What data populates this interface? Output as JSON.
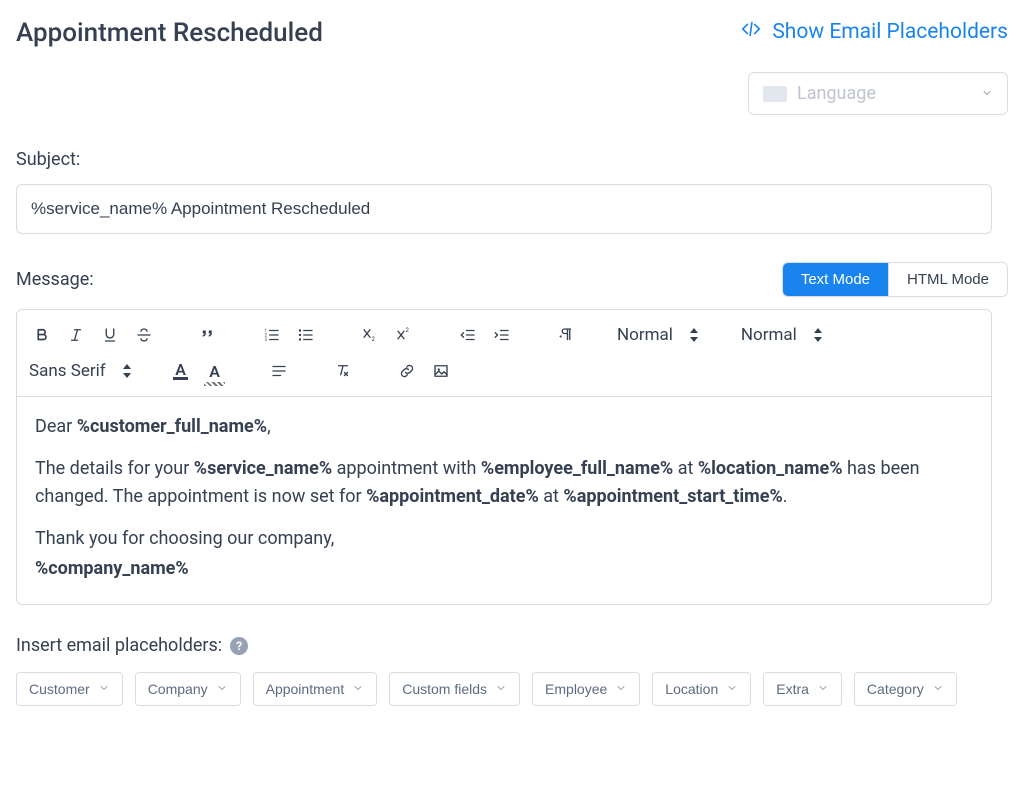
{
  "header": {
    "title": "Appointment Rescheduled",
    "show_placeholders": "Show Email Placeholders",
    "language_placeholder": "Language"
  },
  "subject": {
    "label": "Subject:",
    "value": "%service_name% Appointment Rescheduled"
  },
  "message": {
    "label": "Message:",
    "modes": {
      "text": "Text Mode",
      "html": "HTML Mode",
      "active": "text"
    }
  },
  "toolbar": {
    "select_size": "Normal",
    "select_heading": "Normal",
    "select_font": "Sans Serif"
  },
  "body": {
    "p1": {
      "t1": "Dear ",
      "v1": "%customer_full_name%",
      "t2": ","
    },
    "p2": {
      "t1": "The details for your ",
      "v1": "%service_name%",
      "t2": " appointment with ",
      "v2": "%employee_full_name%",
      "t3": " at ",
      "v3": "%location_name%",
      "t4": " has been changed. The appointment is now set for ",
      "v4": "%appointment_date%",
      "t5": " at ",
      "v5": "%appointment_start_time%",
      "t6": "."
    },
    "p3": {
      "t1": " Thank you for choosing our company,"
    },
    "p4": {
      "v1": "%company_name%"
    }
  },
  "placeholders": {
    "label": "Insert email placeholders:",
    "items": [
      "Customer",
      "Company",
      "Appointment",
      "Custom fields",
      "Employee",
      "Location",
      "Extra",
      "Category"
    ]
  }
}
